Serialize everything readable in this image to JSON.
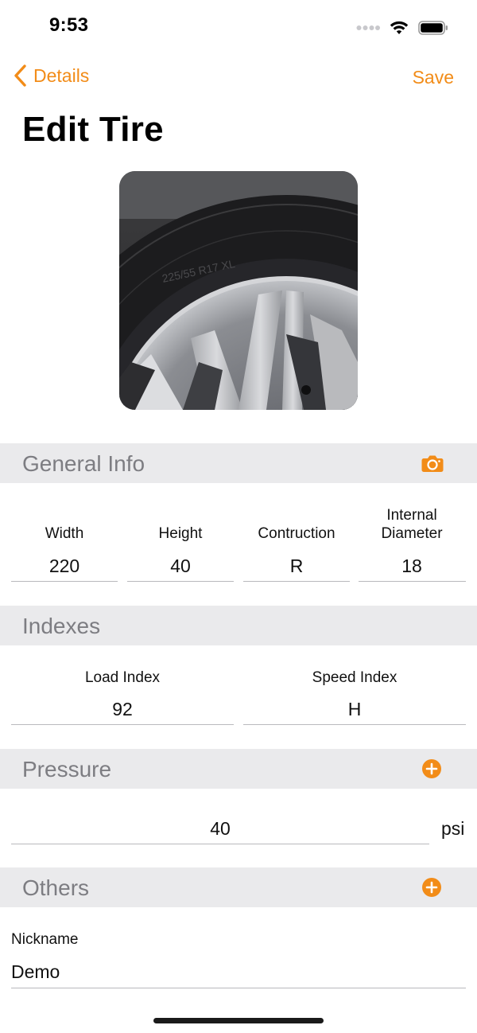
{
  "status_bar": {
    "time": "9:53"
  },
  "nav": {
    "back_label": "Details",
    "save_label": "Save",
    "title": "Edit Tire"
  },
  "colors": {
    "accent": "#f28c18",
    "section_bg": "#eaeaec",
    "section_text": "#7d7d82"
  },
  "general_info": {
    "title": "General Info",
    "icon": "camera-icon",
    "fields": [
      {
        "label": "Width",
        "value": "220"
      },
      {
        "label": "Height",
        "value": "40"
      },
      {
        "label": "Contruction",
        "value": "R"
      },
      {
        "label_line1": "Internal",
        "label_line2": "Diameter",
        "value": "18"
      }
    ]
  },
  "indexes": {
    "title": "Indexes",
    "fields": [
      {
        "label": "Load Index",
        "value": "92"
      },
      {
        "label": "Speed Index",
        "value": "H"
      }
    ]
  },
  "pressure": {
    "title": "Pressure",
    "icon": "add-circle-icon",
    "value": "40",
    "unit": "psi"
  },
  "others": {
    "title": "Others",
    "icon": "add-circle-icon",
    "nickname_label": "Nickname",
    "nickname_value": "Demo"
  }
}
